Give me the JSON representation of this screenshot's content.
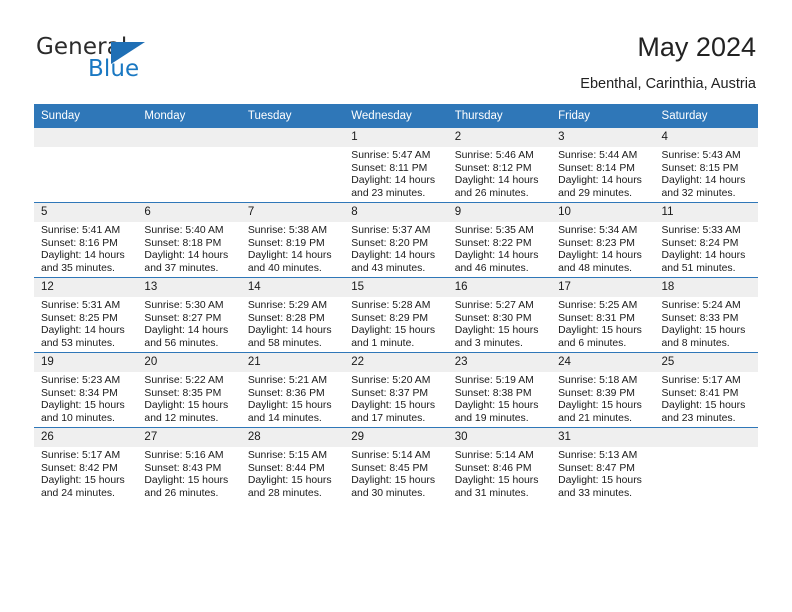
{
  "brand": {
    "name_primary": "General",
    "name_secondary": "Blue",
    "triangle_color": "#1f6fb5",
    "blue_text_color": "#1a78c2"
  },
  "header": {
    "title": "May 2024",
    "subtitle": "Ebenthal, Carinthia, Austria"
  },
  "theme": {
    "header_blue": "#2f77b8",
    "daynum_gray": "#efefef",
    "text": "#1a1a1a"
  },
  "calendar": {
    "weekday_headers": [
      "Sunday",
      "Monday",
      "Tuesday",
      "Wednesday",
      "Thursday",
      "Friday",
      "Saturday"
    ],
    "weeks": [
      [
        {
          "day": "",
          "sunrise": "",
          "sunset": "",
          "daylight": "",
          "empty": true
        },
        {
          "day": "",
          "sunrise": "",
          "sunset": "",
          "daylight": "",
          "empty": true
        },
        {
          "day": "",
          "sunrise": "",
          "sunset": "",
          "daylight": "",
          "empty": true
        },
        {
          "day": "1",
          "sunrise": "Sunrise: 5:47 AM",
          "sunset": "Sunset: 8:11 PM",
          "daylight": "Daylight: 14 hours and 23 minutes."
        },
        {
          "day": "2",
          "sunrise": "Sunrise: 5:46 AM",
          "sunset": "Sunset: 8:12 PM",
          "daylight": "Daylight: 14 hours and 26 minutes."
        },
        {
          "day": "3",
          "sunrise": "Sunrise: 5:44 AM",
          "sunset": "Sunset: 8:14 PM",
          "daylight": "Daylight: 14 hours and 29 minutes."
        },
        {
          "day": "4",
          "sunrise": "Sunrise: 5:43 AM",
          "sunset": "Sunset: 8:15 PM",
          "daylight": "Daylight: 14 hours and 32 minutes."
        }
      ],
      [
        {
          "day": "5",
          "sunrise": "Sunrise: 5:41 AM",
          "sunset": "Sunset: 8:16 PM",
          "daylight": "Daylight: 14 hours and 35 minutes."
        },
        {
          "day": "6",
          "sunrise": "Sunrise: 5:40 AM",
          "sunset": "Sunset: 8:18 PM",
          "daylight": "Daylight: 14 hours and 37 minutes."
        },
        {
          "day": "7",
          "sunrise": "Sunrise: 5:38 AM",
          "sunset": "Sunset: 8:19 PM",
          "daylight": "Daylight: 14 hours and 40 minutes."
        },
        {
          "day": "8",
          "sunrise": "Sunrise: 5:37 AM",
          "sunset": "Sunset: 8:20 PM",
          "daylight": "Daylight: 14 hours and 43 minutes."
        },
        {
          "day": "9",
          "sunrise": "Sunrise: 5:35 AM",
          "sunset": "Sunset: 8:22 PM",
          "daylight": "Daylight: 14 hours and 46 minutes."
        },
        {
          "day": "10",
          "sunrise": "Sunrise: 5:34 AM",
          "sunset": "Sunset: 8:23 PM",
          "daylight": "Daylight: 14 hours and 48 minutes."
        },
        {
          "day": "11",
          "sunrise": "Sunrise: 5:33 AM",
          "sunset": "Sunset: 8:24 PM",
          "daylight": "Daylight: 14 hours and 51 minutes."
        }
      ],
      [
        {
          "day": "12",
          "sunrise": "Sunrise: 5:31 AM",
          "sunset": "Sunset: 8:25 PM",
          "daylight": "Daylight: 14 hours and 53 minutes."
        },
        {
          "day": "13",
          "sunrise": "Sunrise: 5:30 AM",
          "sunset": "Sunset: 8:27 PM",
          "daylight": "Daylight: 14 hours and 56 minutes."
        },
        {
          "day": "14",
          "sunrise": "Sunrise: 5:29 AM",
          "sunset": "Sunset: 8:28 PM",
          "daylight": "Daylight: 14 hours and 58 minutes."
        },
        {
          "day": "15",
          "sunrise": "Sunrise: 5:28 AM",
          "sunset": "Sunset: 8:29 PM",
          "daylight": "Daylight: 15 hours and 1 minute."
        },
        {
          "day": "16",
          "sunrise": "Sunrise: 5:27 AM",
          "sunset": "Sunset: 8:30 PM",
          "daylight": "Daylight: 15 hours and 3 minutes."
        },
        {
          "day": "17",
          "sunrise": "Sunrise: 5:25 AM",
          "sunset": "Sunset: 8:31 PM",
          "daylight": "Daylight: 15 hours and 6 minutes."
        },
        {
          "day": "18",
          "sunrise": "Sunrise: 5:24 AM",
          "sunset": "Sunset: 8:33 PM",
          "daylight": "Daylight: 15 hours and 8 minutes."
        }
      ],
      [
        {
          "day": "19",
          "sunrise": "Sunrise: 5:23 AM",
          "sunset": "Sunset: 8:34 PM",
          "daylight": "Daylight: 15 hours and 10 minutes."
        },
        {
          "day": "20",
          "sunrise": "Sunrise: 5:22 AM",
          "sunset": "Sunset: 8:35 PM",
          "daylight": "Daylight: 15 hours and 12 minutes."
        },
        {
          "day": "21",
          "sunrise": "Sunrise: 5:21 AM",
          "sunset": "Sunset: 8:36 PM",
          "daylight": "Daylight: 15 hours and 14 minutes."
        },
        {
          "day": "22",
          "sunrise": "Sunrise: 5:20 AM",
          "sunset": "Sunset: 8:37 PM",
          "daylight": "Daylight: 15 hours and 17 minutes."
        },
        {
          "day": "23",
          "sunrise": "Sunrise: 5:19 AM",
          "sunset": "Sunset: 8:38 PM",
          "daylight": "Daylight: 15 hours and 19 minutes."
        },
        {
          "day": "24",
          "sunrise": "Sunrise: 5:18 AM",
          "sunset": "Sunset: 8:39 PM",
          "daylight": "Daylight: 15 hours and 21 minutes."
        },
        {
          "day": "25",
          "sunrise": "Sunrise: 5:17 AM",
          "sunset": "Sunset: 8:41 PM",
          "daylight": "Daylight: 15 hours and 23 minutes."
        }
      ],
      [
        {
          "day": "26",
          "sunrise": "Sunrise: 5:17 AM",
          "sunset": "Sunset: 8:42 PM",
          "daylight": "Daylight: 15 hours and 24 minutes."
        },
        {
          "day": "27",
          "sunrise": "Sunrise: 5:16 AM",
          "sunset": "Sunset: 8:43 PM",
          "daylight": "Daylight: 15 hours and 26 minutes."
        },
        {
          "day": "28",
          "sunrise": "Sunrise: 5:15 AM",
          "sunset": "Sunset: 8:44 PM",
          "daylight": "Daylight: 15 hours and 28 minutes."
        },
        {
          "day": "29",
          "sunrise": "Sunrise: 5:14 AM",
          "sunset": "Sunset: 8:45 PM",
          "daylight": "Daylight: 15 hours and 30 minutes."
        },
        {
          "day": "30",
          "sunrise": "Sunrise: 5:14 AM",
          "sunset": "Sunset: 8:46 PM",
          "daylight": "Daylight: 15 hours and 31 minutes."
        },
        {
          "day": "31",
          "sunrise": "Sunrise: 5:13 AM",
          "sunset": "Sunset: 8:47 PM",
          "daylight": "Daylight: 15 hours and 33 minutes."
        },
        {
          "day": "",
          "sunrise": "",
          "sunset": "",
          "daylight": "",
          "empty": true
        }
      ]
    ]
  }
}
